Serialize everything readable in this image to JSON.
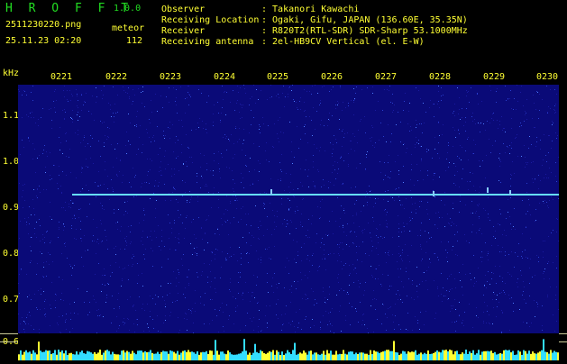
{
  "header": {
    "app_name": "H R O F F T",
    "version": "1.0.0",
    "filename": "2511230220.png",
    "datetime": "25.11.23 02:20",
    "meteor_label": "meteor",
    "meteor_count": "112",
    "info": [
      {
        "key": "Observer",
        "value": ": Takanori Kawachi"
      },
      {
        "key": "Receiving Location",
        "value": ": Ogaki, Gifu, JAPAN (136.60E, 35.35N)"
      },
      {
        "key": "Receiver",
        "value": ": R820T2(RTL-SDR) SDR-Sharp 53.1000MHz"
      },
      {
        "key": "Receiving antenna",
        "value": ": 2el-HB9CV Vertical (el. E-W)"
      }
    ]
  },
  "time_axis": {
    "ticks": [
      "0221",
      "0222",
      "0223",
      "0224",
      "0225",
      "0226",
      "0227",
      "0228",
      "0229",
      "0230"
    ]
  },
  "freq_axis": {
    "unit": "kHz",
    "ticks": [
      "1.1",
      "1.0",
      "0.9",
      "0.8",
      "0.7",
      "0.6"
    ]
  },
  "colors": {
    "label": "#ffff33",
    "title": "#22dd22",
    "background": "#0a0a78",
    "carrier": "#66ddff"
  }
}
